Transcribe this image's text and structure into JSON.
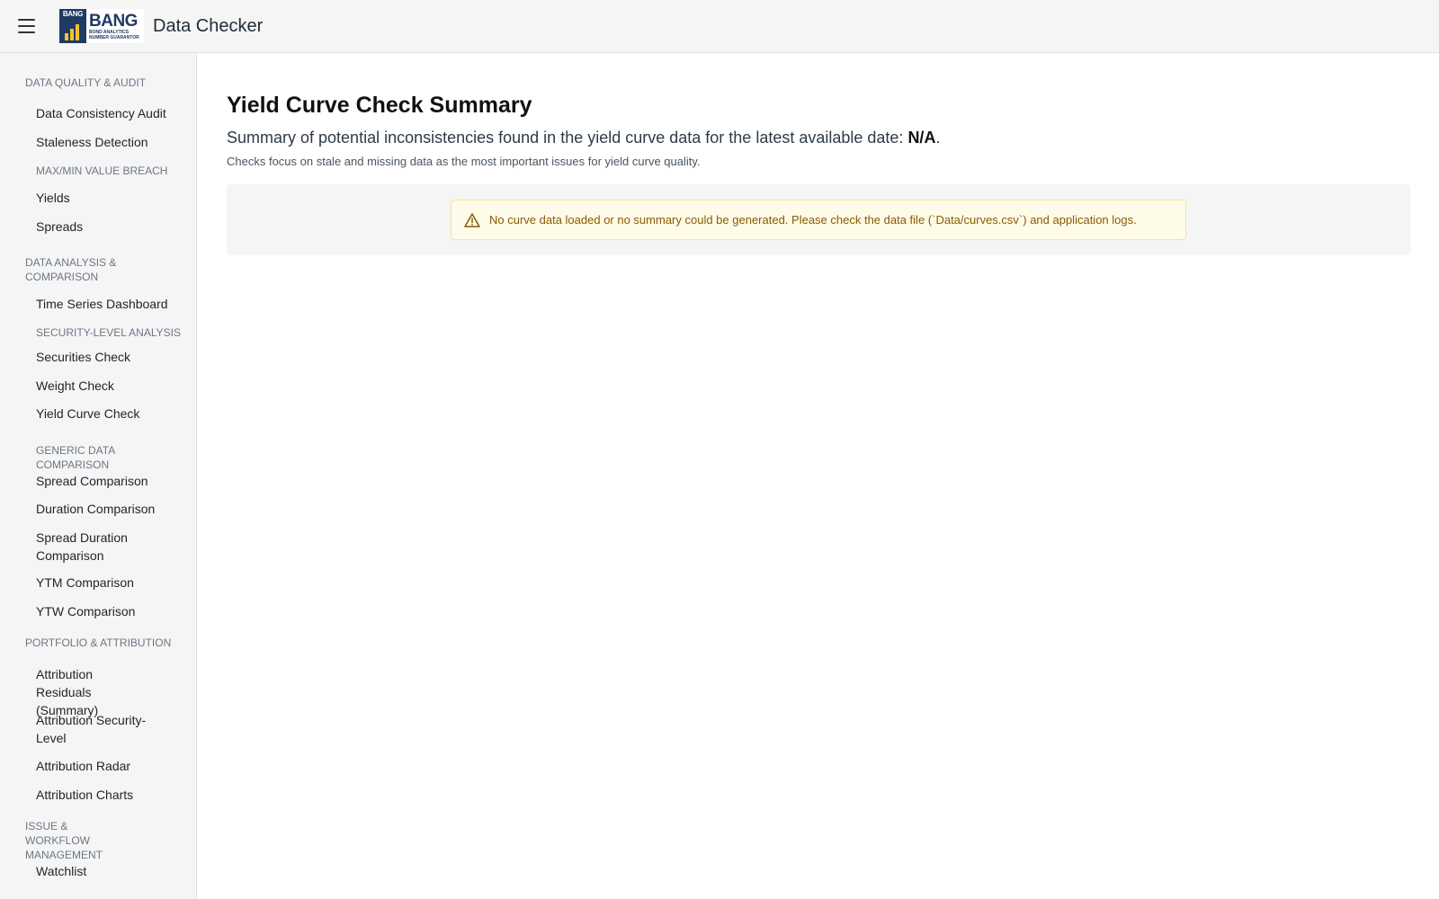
{
  "header": {
    "logo": {
      "badge_text": "BANG",
      "name": "BANG",
      "tagline_1": "BOND ANALYTICS",
      "tagline_2": "NUMBER GUARANTOR"
    },
    "title": "Data Checker"
  },
  "sidebar": {
    "sections": [
      {
        "heading": "DATA QUALITY & AUDIT",
        "items": [
          "Data Consistency Audit",
          "Staleness Detection"
        ]
      },
      {
        "subheading": "MAX/MIN VALUE BREACH",
        "items": [
          "Yields",
          "Spreads"
        ]
      },
      {
        "heading": "DATA ANALYSIS & COMPARISON",
        "items": [
          "Time Series Dashboard"
        ]
      },
      {
        "subheading": "SECURITY-LEVEL ANALYSIS",
        "items": [
          "Securities Check",
          "Weight Check",
          "Yield Curve Check"
        ]
      },
      {
        "subheading": "GENERIC DATA COMPARISON",
        "items": [
          "Spread Comparison",
          "Duration Comparison",
          "Spread Duration Comparison",
          "YTM Comparison",
          "YTW Comparison"
        ]
      },
      {
        "heading": "PORTFOLIO & ATTRIBUTION",
        "items": [
          "Attribution Residuals (Summary)",
          "Attribution Security-Level",
          "Attribution Radar",
          "Attribution Charts"
        ]
      },
      {
        "heading": "ISSUE & WORKFLOW MANAGEMENT",
        "items": [
          "Watchlist"
        ]
      }
    ]
  },
  "main": {
    "title": "Yield Curve Check Summary",
    "lead_prefix": "Summary of potential inconsistencies found in the yield curve data for the latest available date: ",
    "lead_date": "N/A",
    "lead_suffix": ".",
    "note": "Checks focus on stale and missing data as the most important issues for yield curve quality.",
    "alert": {
      "icon": "warning-icon",
      "text": "No curve data loaded or no summary could be generated. Please check the data file (`Data/curves.csv`) and application logs."
    }
  },
  "colors": {
    "alert_bg": "#fefbe8",
    "alert_border": "#f5e59a",
    "alert_text": "#8a5a00",
    "brand": "#1f3a63"
  }
}
